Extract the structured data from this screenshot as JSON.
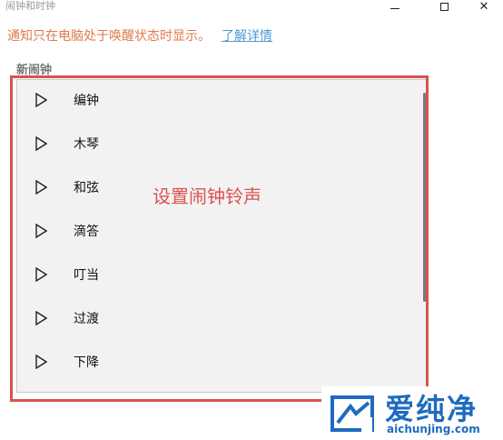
{
  "window": {
    "title": "闹钟和时钟"
  },
  "notice": {
    "text": "通知只在电脑处于唤醒状态时显示。",
    "link": "了解详情"
  },
  "section": {
    "title": "新闹钟"
  },
  "sounds": [
    {
      "label": "编钟"
    },
    {
      "label": "木琴"
    },
    {
      "label": "和弦"
    },
    {
      "label": "滴答"
    },
    {
      "label": "叮当"
    },
    {
      "label": "过渡"
    },
    {
      "label": "下降"
    }
  ],
  "annotation": {
    "text": "设置闹钟铃声"
  },
  "watermark": {
    "brand": "爱纯净",
    "url": "aichunjing.com"
  },
  "colors": {
    "notice": "#e07a4a",
    "link": "#4a9bd8",
    "highlight": "#d9534f",
    "watermark": "#1e6bbf"
  },
  "icons": {
    "play": "play-icon",
    "minimize": "minimize-icon",
    "maximize": "maximize-icon",
    "close": "close-icon"
  }
}
